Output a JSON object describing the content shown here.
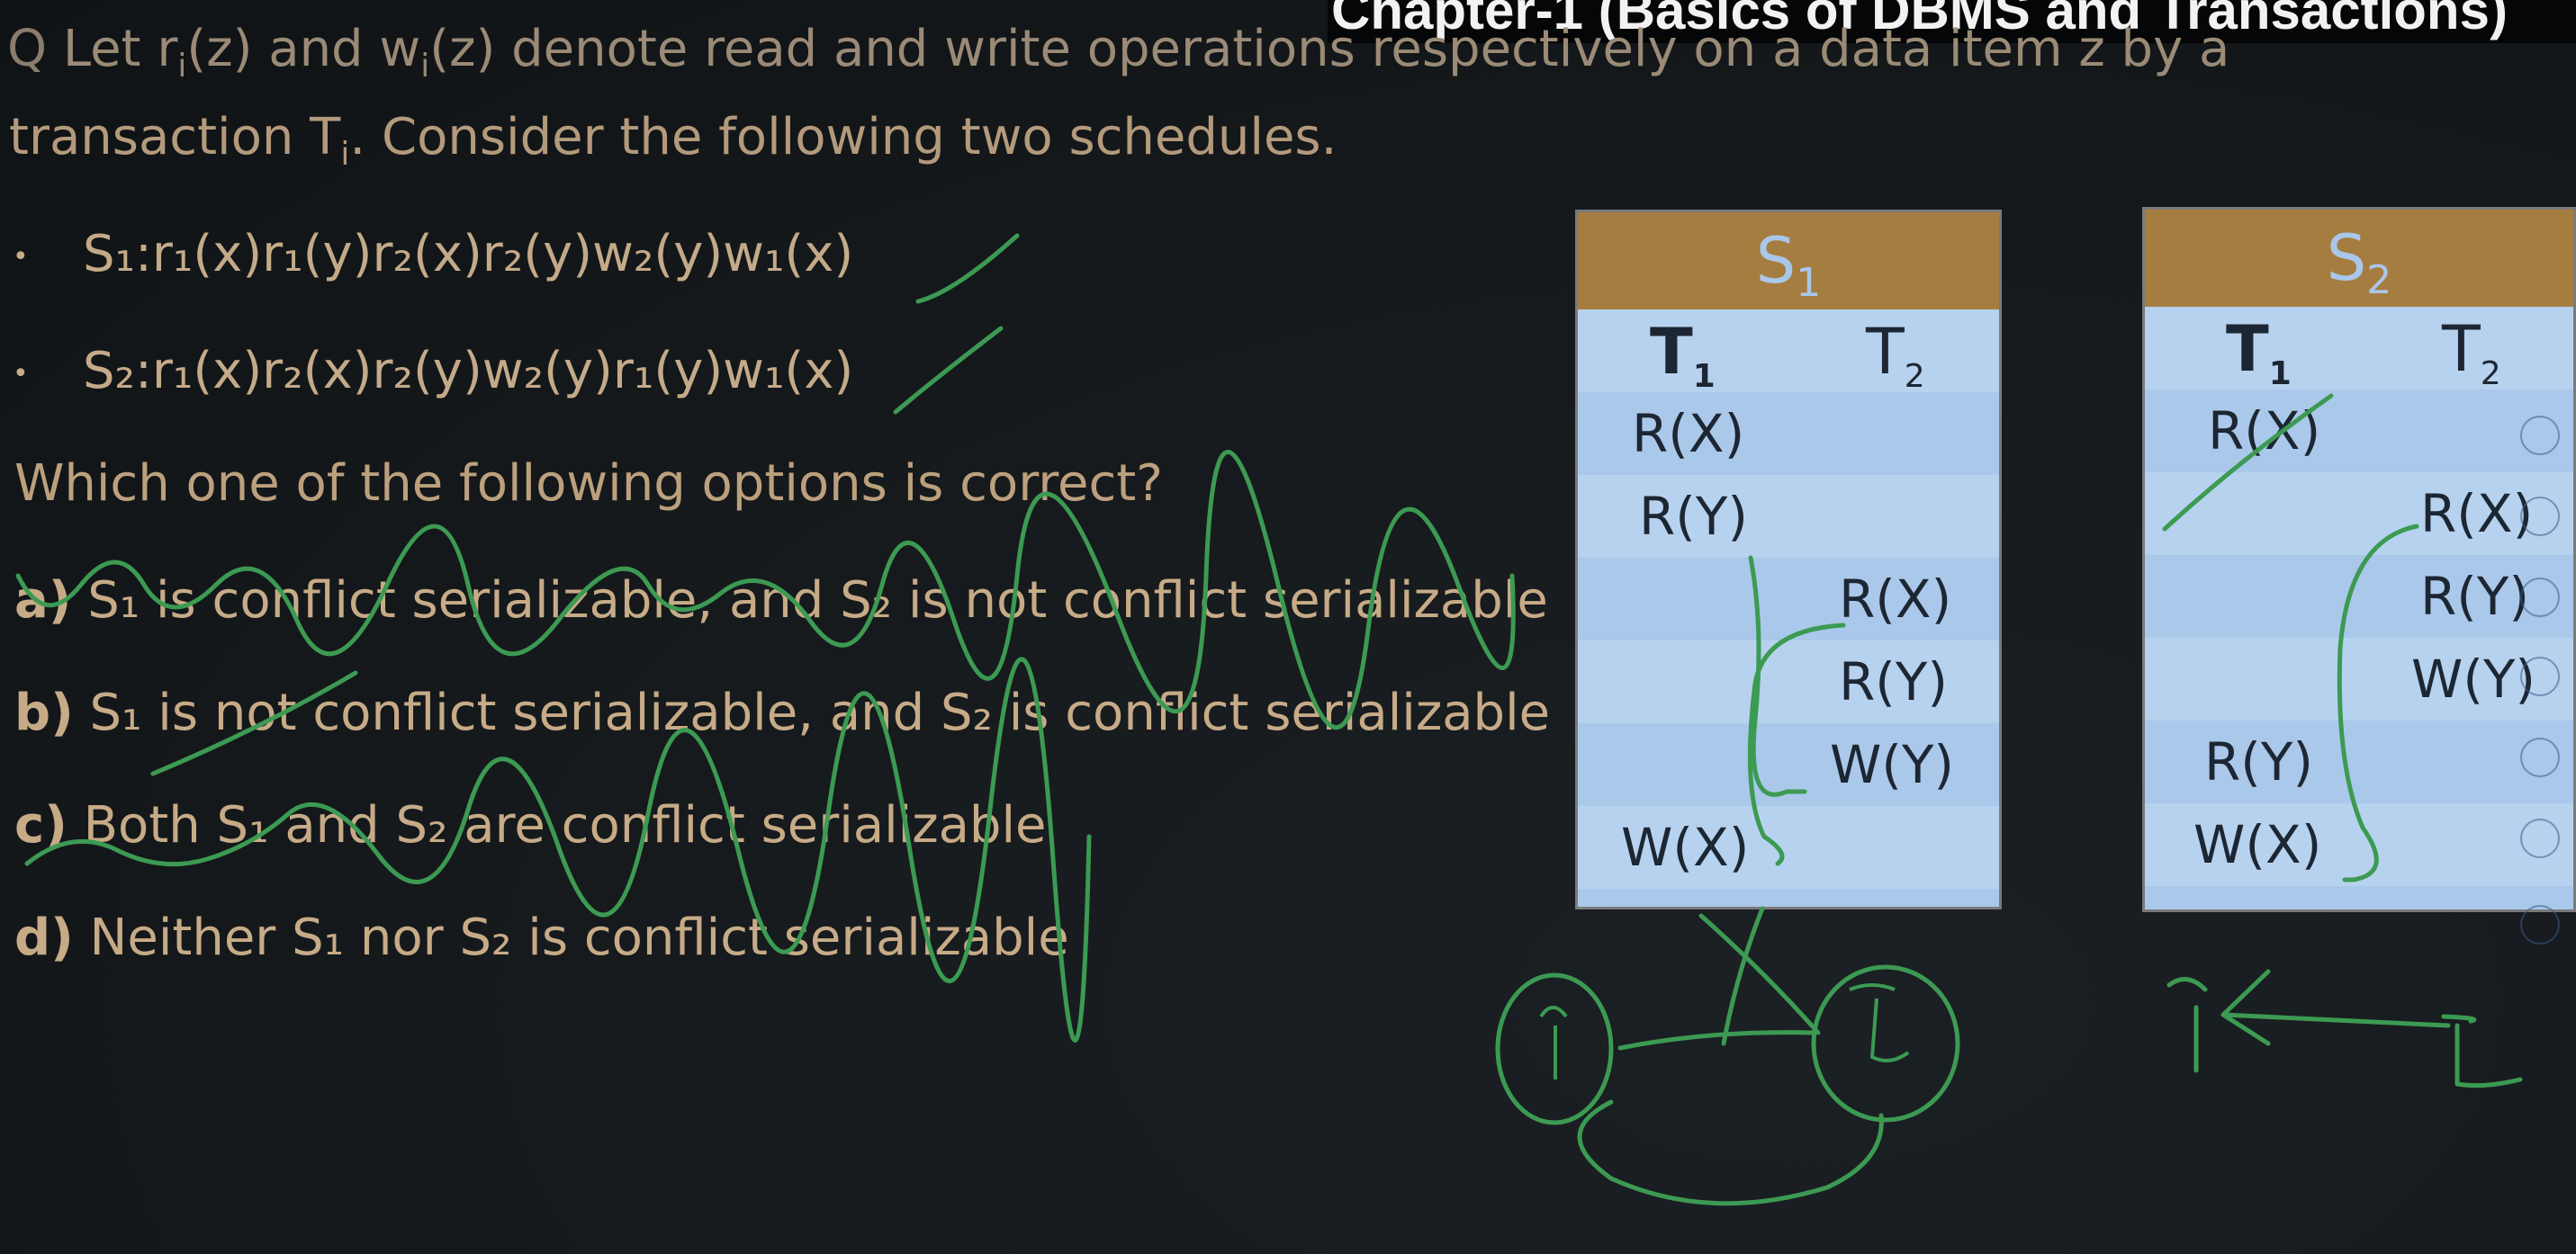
{
  "header": {
    "chapter_title": "Chapter-1 (Basics of DBMS and Transactions)"
  },
  "question": {
    "q_marker": "Q",
    "line1": "Let r",
    "line1_sub_i": "i",
    "line1_mid": "(z) and w",
    "line1_sub_i2": "i",
    "line1_end": "(z) denote read and write operations respectively on a data item z by a",
    "line2_start": "transaction T",
    "line2_sub": "i",
    "line2_end": ". Consider the following two schedules.",
    "schedule1": "S₁:r₁(x)r₁(y)r₂(x)r₂(y)w₂(y)w₁(x)",
    "schedule2": "S₂:r₁(x)r₂(x)r₂(y)w₂(y)r₁(y)w₁(x)",
    "prompt": "Which one of the following options is correct?",
    "bullet": "•"
  },
  "options": {
    "a": {
      "letter": "a)",
      "text": "S₁ is conflict serializable, and S₂ is not conflict serializable"
    },
    "b": {
      "letter": "b)",
      "text": "S₁ is not conflict serializable, and S₂ is conflict serializable"
    },
    "c": {
      "letter": "c)",
      "text": "Both S₁ and S₂ are conflict serializable"
    },
    "d": {
      "letter": "d)",
      "text": "Neither S₁ nor S₂ is conflict serializable"
    }
  },
  "table_s1": {
    "title": "S",
    "title_sub": "1",
    "col1": "T",
    "col1_sub": "1",
    "col2": "T",
    "col2_sub": "2",
    "rows": [
      {
        "t1": "R(X)",
        "t2": ""
      },
      {
        "t1": "R(Y)",
        "t2": ""
      },
      {
        "t1": "",
        "t2": "R(X)"
      },
      {
        "t1": "",
        "t2": "R(Y)"
      },
      {
        "t1": "",
        "t2": "W(Y)"
      },
      {
        "t1": "W(X)",
        "t2": ""
      }
    ]
  },
  "table_s2": {
    "title": "S",
    "title_sub": "2",
    "col1": "T",
    "col1_sub": "1",
    "col2": "T",
    "col2_sub": "2",
    "rows": [
      {
        "t1": "R(X)",
        "t2": ""
      },
      {
        "t1": "",
        "t2": "R(X)"
      },
      {
        "t1": "",
        "t2": "R(Y)"
      },
      {
        "t1": "",
        "t2": "W(Y)"
      },
      {
        "t1": "R(Y)",
        "t2": ""
      },
      {
        "t1": "W(X)",
        "t2": ""
      }
    ]
  },
  "colors": {
    "ink": "#3c9a52",
    "text": "#c7ab87",
    "table_bg": "#aac8ea",
    "table_head": "#a67d40"
  }
}
